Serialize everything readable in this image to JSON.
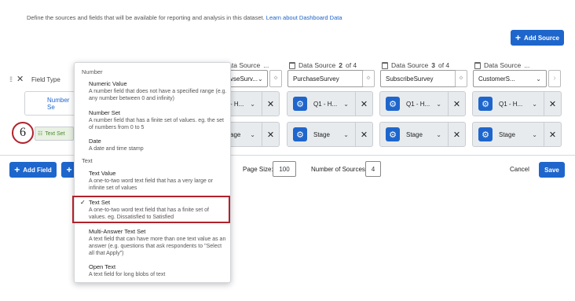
{
  "description": {
    "text": "Define the sources and fields that will be available for reporting and analysis in this dataset.",
    "link": "Learn about Dashboard Data"
  },
  "add_source_label": "Add Source",
  "header": {
    "field_type_label": "Field Type",
    "sources": [
      {
        "title_prefix": "Data Source",
        "title_num": "",
        "title_suffix": "...",
        "selected": "vseSurv..."
      },
      {
        "title_prefix": "Data Source",
        "title_num": "2",
        "title_suffix": "of 4",
        "selected": "PurchaseSurvey"
      },
      {
        "title_prefix": "Data Source",
        "title_num": "3",
        "title_suffix": "of 4",
        "selected": "SubscribeSurvey"
      },
      {
        "title_prefix": "Data Source",
        "title_num": "",
        "title_suffix": "...",
        "selected": "CustomerS..."
      }
    ]
  },
  "rows": [
    {
      "field_type": "Number Se",
      "cells": [
        "- H...",
        "Q1 - H...",
        "Q1 - H...",
        "Q1 - H..."
      ]
    },
    {
      "field_type": "Text Set",
      "cells": [
        "age",
        "Stage",
        "Stage",
        "Stage"
      ]
    }
  ],
  "step_number": "6",
  "footer": {
    "add_field_label": "Add Field",
    "page_size_label": "Page Size:",
    "page_size_value": "100",
    "num_sources_label": "Number of Sources:",
    "num_sources_value": "4",
    "cancel_label": "Cancel",
    "save_label": "Save"
  },
  "dropdown": {
    "number_group": "Number",
    "text_group": "Text",
    "options": [
      {
        "title": "Numeric Value",
        "desc": "A number field that does not have a specified range (e.g. any number between 0 and infinity)"
      },
      {
        "title": "Number Set",
        "desc": "A number field that has a finite set of values. eg. the set of numbers from 0 to 5"
      },
      {
        "title": "Date",
        "desc": "A date and time stamp"
      },
      {
        "title": "Text Value",
        "desc": "A one-to-two word text field that has a very large or infinite set of values"
      },
      {
        "title": "Text Set",
        "desc": "A one-to-two word text field that has a finite set of values. eg. Dissatisfied to Satisfied",
        "selected": true
      },
      {
        "title": "Multi-Answer Text Set",
        "desc": "A text field that can have more than one text value as an answer (e.g. questions that ask respondents to \"Select all that Apply\")"
      },
      {
        "title": "Open Text",
        "desc": "A text field for long blobs of text"
      }
    ]
  },
  "colors": {
    "primary": "#1e66cc",
    "highlight": "#b1222c",
    "link": "#1c63c9"
  },
  "icons": [
    "plus-icon",
    "gear-icon",
    "chevron-down-icon",
    "close-icon",
    "calendar-icon",
    "checkmark-icon",
    "drag-handle-icon"
  ]
}
